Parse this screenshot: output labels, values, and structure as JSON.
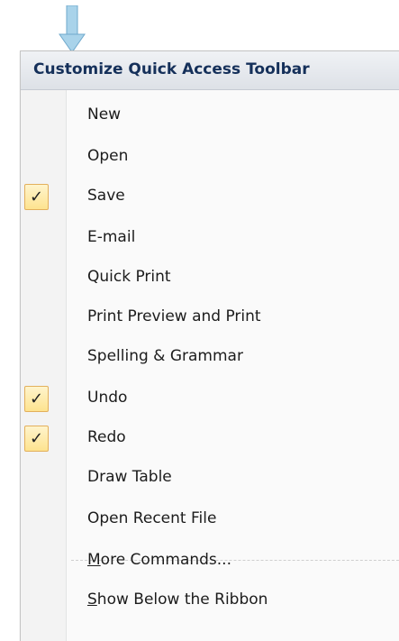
{
  "menu": {
    "title": "Customize Quick Access Toolbar",
    "check_glyph": "✓",
    "items": [
      {
        "label": "New",
        "checked": false
      },
      {
        "label": "Open",
        "checked": false
      },
      {
        "label": "Save",
        "checked": true
      },
      {
        "label": "E-mail",
        "checked": false
      },
      {
        "label": "Quick Print",
        "checked": false
      },
      {
        "label": "Print Preview and Print",
        "checked": false
      },
      {
        "label": "Spelling & Grammar",
        "checked": false
      },
      {
        "label": "Undo",
        "checked": true
      },
      {
        "label": "Redo",
        "checked": true
      },
      {
        "label": "Draw Table",
        "checked": false
      },
      {
        "label": "Open Recent File",
        "checked": false
      }
    ],
    "more_commands": {
      "mnemonic": "M",
      "rest": "ore Commands..."
    },
    "show_below": {
      "mnemonic": "S",
      "rest": "how Below the Ribbon"
    }
  },
  "colors": {
    "arrow": "#8fc3e0",
    "header_text": "#15305a",
    "check_bg": "#fde38f",
    "check_border": "#e3b05c"
  }
}
